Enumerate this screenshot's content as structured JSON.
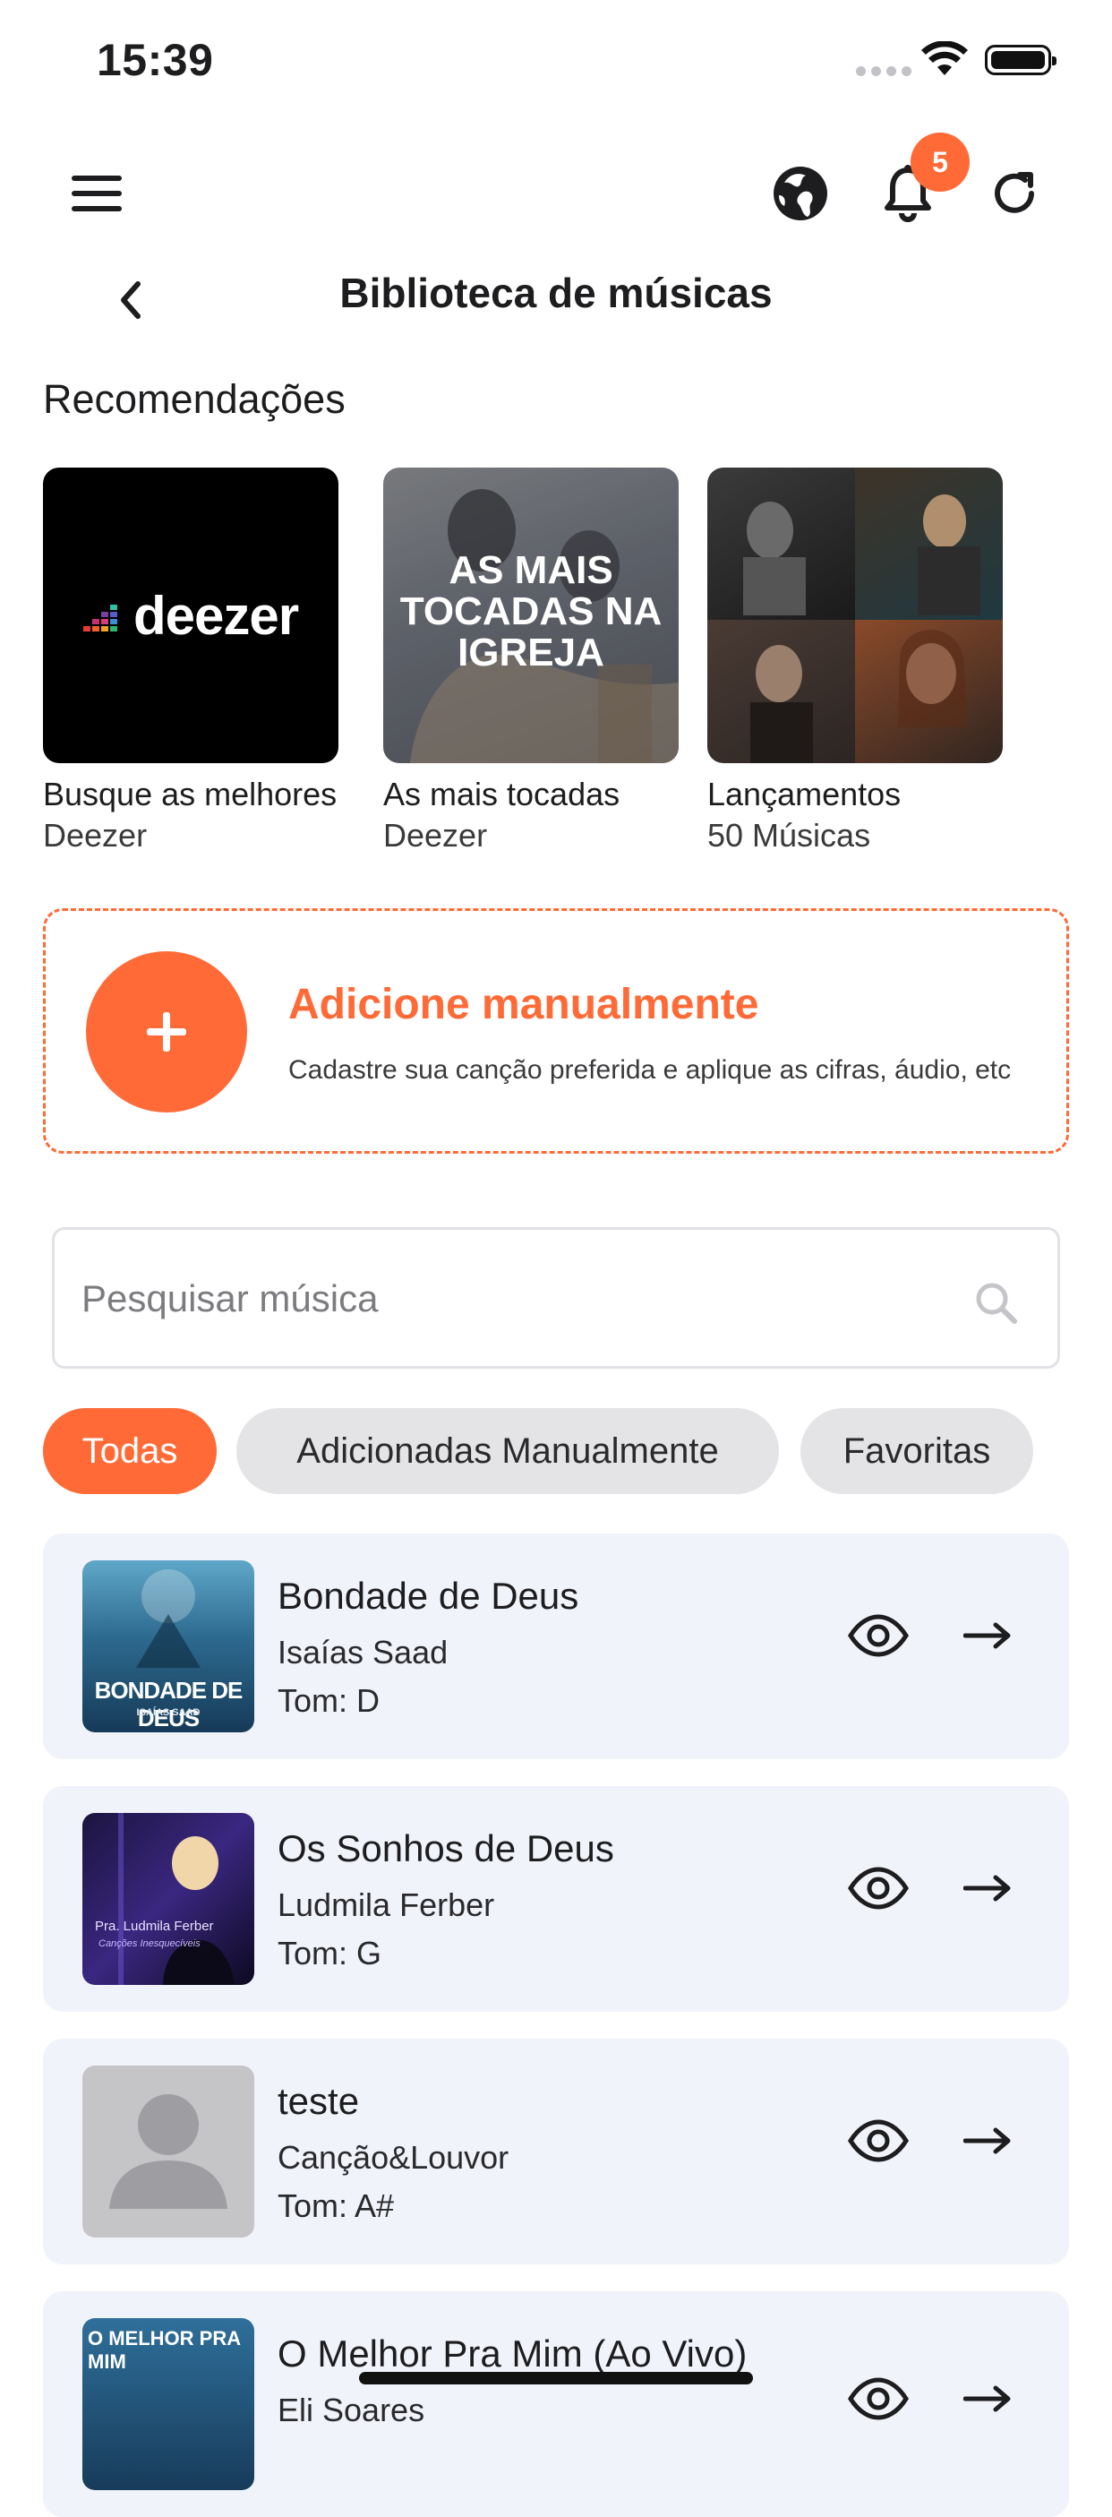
{
  "status_bar": {
    "time": "15:39"
  },
  "header": {
    "notification_count": "5",
    "page_title": "Biblioteca de músicas"
  },
  "recommendations": {
    "section_title": "Recomendações",
    "items": [
      {
        "title": "Busque as melhores",
        "subtitle": "Deezer",
        "cover_text": "deezer"
      },
      {
        "title": "As mais tocadas",
        "subtitle": "Deezer",
        "cover_text": "AS MAIS TOCADAS NA IGREJA"
      },
      {
        "title": "Lançamentos",
        "subtitle": "50 Músicas"
      }
    ]
  },
  "add_manual": {
    "title": "Adicione manualmente",
    "description": "Cadastre sua canção preferida e aplique as cifras, áudio, etc"
  },
  "search": {
    "placeholder": "Pesquisar música",
    "value": ""
  },
  "filters": [
    {
      "label": "Todas",
      "active": true
    },
    {
      "label": "Adicionadas Manualmente",
      "active": false
    },
    {
      "label": "Favoritas",
      "active": false
    }
  ],
  "songs": [
    {
      "title": "Bondade de Deus",
      "artist": "Isaías Saad",
      "key": "Tom: D"
    },
    {
      "title": "Os Sonhos de Deus",
      "artist": "Ludmila Ferber",
      "key": "Tom: G"
    },
    {
      "title": "teste",
      "artist": "Canção&Louvor",
      "key": "Tom: A#"
    },
    {
      "title": "O Melhor Pra Mim (Ao Vivo)",
      "artist": "Eli Soares",
      "key": ""
    }
  ],
  "colors": {
    "accent": "#ff6a37",
    "card_bg": "#f1f3fa",
    "chip_inactive": "#e4e4e6"
  },
  "icons": [
    "menu-icon",
    "globe-icon",
    "bell-icon",
    "refresh-icon",
    "back-icon",
    "plus-icon",
    "search-icon",
    "eye-icon",
    "arrow-right-icon"
  ]
}
